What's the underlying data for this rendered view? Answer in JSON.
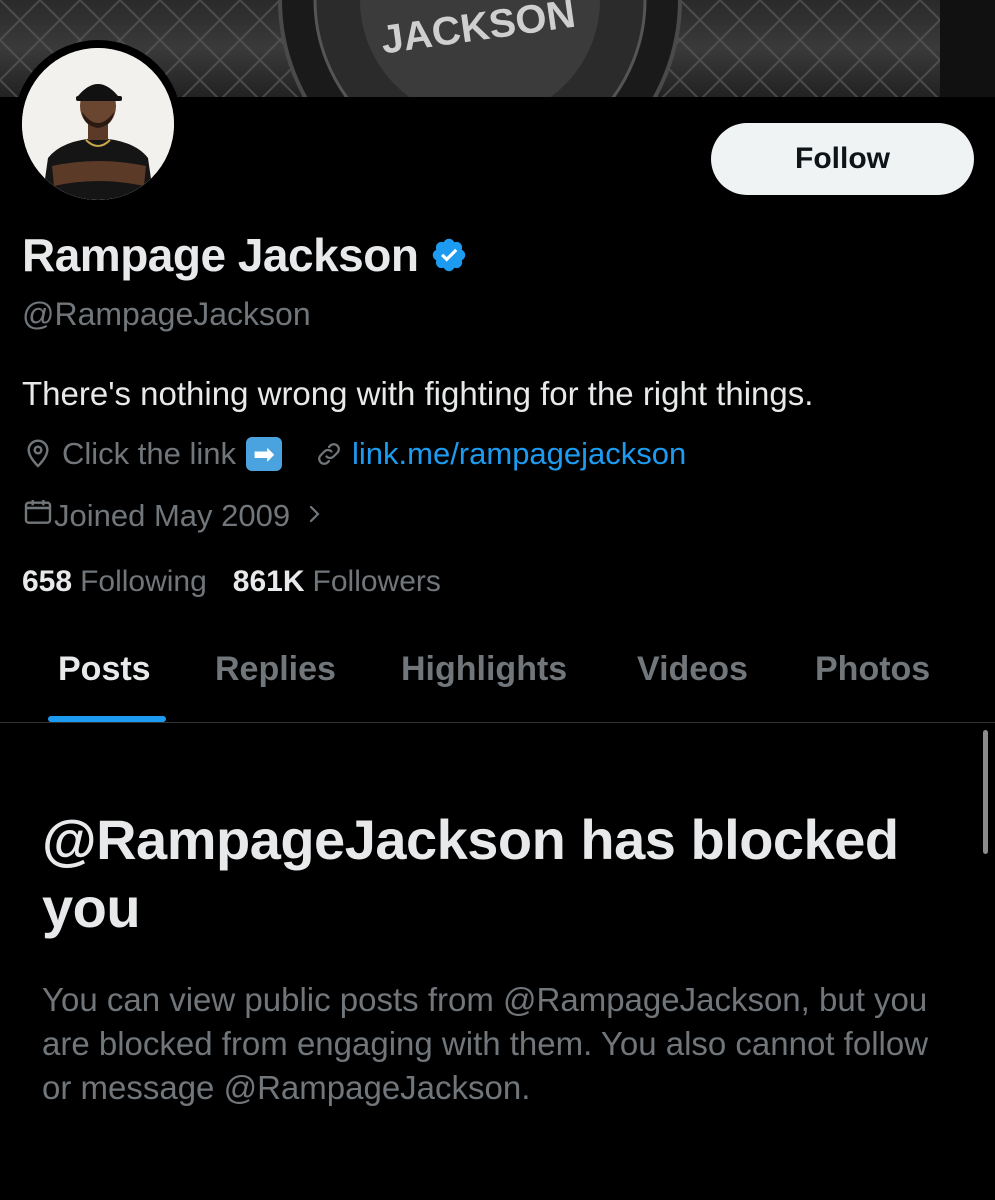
{
  "profile": {
    "name": "Rampage Jackson",
    "handle": "@RampageJackson",
    "bio": "There's nothing wrong with fighting for the right things.",
    "location": "Click the link",
    "location_emoji": "➡",
    "website": "link.me/rampagejackson",
    "joined": "Joined May 2009",
    "following_count": "658",
    "following_label": "Following",
    "followers_count": "861K",
    "followers_label": "Followers",
    "verified_color": "#1d9bf0"
  },
  "actions": {
    "follow_label": "Follow"
  },
  "tabs": [
    {
      "label": "Posts",
      "active": true
    },
    {
      "label": "Replies",
      "active": false
    },
    {
      "label": "Highlights",
      "active": false
    },
    {
      "label": "Videos",
      "active": false
    },
    {
      "label": "Photos",
      "active": false
    }
  ],
  "blocked": {
    "title": "@RampageJackson has blocked you",
    "message": "You can view public posts from @RampageJackson, but you are blocked from engaging with them. You also cannot follow or message @RampageJackson."
  },
  "banner": {
    "text": "JACKSON"
  },
  "icons": {
    "location": "location-pin-icon",
    "link": "link-icon",
    "calendar": "calendar-icon",
    "chevron": "chevron-right-icon",
    "verified": "verified-badge-icon"
  },
  "colors": {
    "background": "#000000",
    "accent": "#1d9bf0",
    "primary_text": "#e7e9ea",
    "secondary_text": "#71767b",
    "button_bg": "#eff3f4"
  }
}
